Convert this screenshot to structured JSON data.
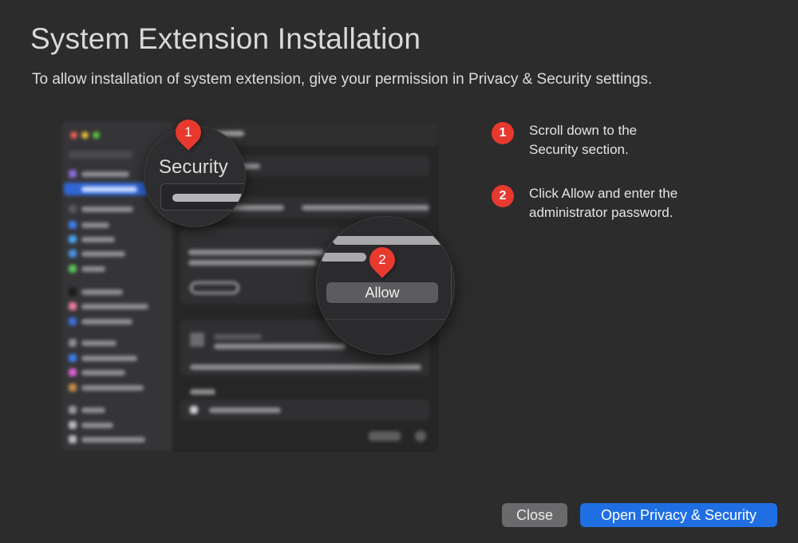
{
  "dialog": {
    "title": "System Extension Installation",
    "subtitle": "To allow installation of system extension, give your permission in Privacy & Security settings."
  },
  "illustration": {
    "magnifier_security_label": "Security",
    "magnifier_allow_label": "Allow",
    "pin_1": "1",
    "pin_2": "2"
  },
  "steps": [
    {
      "number": "1",
      "text": "Scroll down to the Security section."
    },
    {
      "number": "2",
      "text": "Click Allow and enter the administrator password."
    }
  ],
  "buttons": {
    "close": "Close",
    "open": "Open Privacy & Security"
  },
  "colors": {
    "accent": "#1f6fe3",
    "badge": "#e8392f",
    "background": "#2c2c2d"
  }
}
